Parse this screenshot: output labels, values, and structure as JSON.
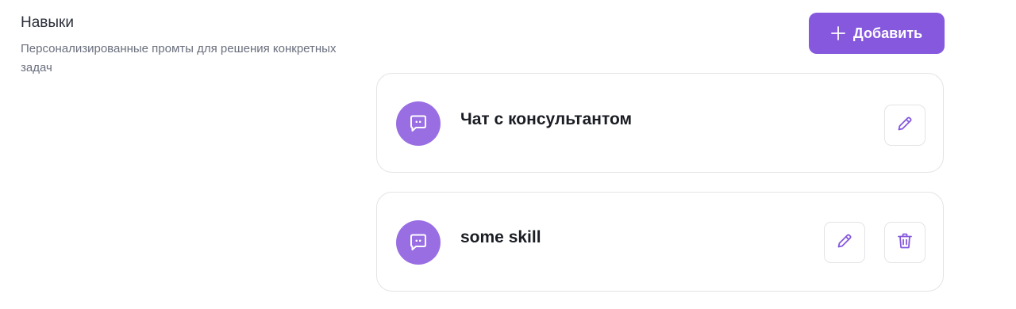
{
  "section": {
    "title": "Навыки",
    "description": "Персонализированные промты для решения конкретных задач"
  },
  "add_button": {
    "label": "Добавить",
    "icon": "plus-icon"
  },
  "skills": [
    {
      "name": "Чат с консультантом",
      "icon": "chat-icon",
      "actions": [
        "edit"
      ]
    },
    {
      "name": "some skill",
      "icon": "chat-icon",
      "actions": [
        "edit",
        "delete"
      ]
    }
  ],
  "colors": {
    "accent": "#8558dd",
    "avatar": "#9a6ee3",
    "border": "#e4e4e7",
    "title": "#2b2f3a",
    "muted": "#6a6f7d"
  }
}
